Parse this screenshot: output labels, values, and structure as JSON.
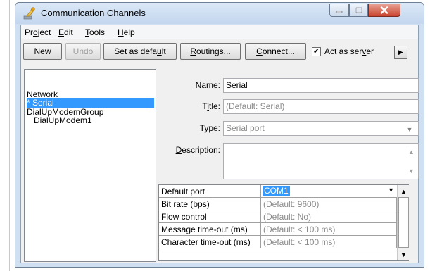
{
  "window": {
    "title": "Communication Channels",
    "icon": "app-icon",
    "controls": [
      "minimize-icon",
      "maximize-icon",
      "close-icon"
    ]
  },
  "menu": [
    {
      "pre": "Pr",
      "key": "o",
      "post": "ject"
    },
    {
      "pre": "",
      "key": "E",
      "post": "dit"
    },
    {
      "pre": "",
      "key": "T",
      "post": "ools"
    },
    {
      "pre": "",
      "key": "H",
      "post": "elp"
    }
  ],
  "toolbar": {
    "new": "New",
    "undo": "Undo",
    "set_default_pre": "Set as defa",
    "set_default_key": "u",
    "set_default_post": "lt",
    "routings_key": "R",
    "routings_post": "outings...",
    "connect_key": "C",
    "connect_post": "onnect...",
    "act_as_server_pre": "Act as ser",
    "act_as_server_key": "v",
    "act_as_server_post": "er",
    "act_as_server_checked": true
  },
  "tree": {
    "items": [
      "Network",
      "* Serial",
      "DialUpModemGroup",
      "DialUpModem1"
    ],
    "selected": "* Serial"
  },
  "form": {
    "name_label_key": "N",
    "name_label_post": "ame:",
    "name_value": "Serial",
    "title_label_pre": "T",
    "title_label_key": "i",
    "title_label_post": "tle:",
    "title_value": "(Default: Serial)",
    "type_label_pre": "T",
    "type_label_key": "y",
    "type_label_post": "pe:",
    "type_value": "Serial port",
    "description_label_key": "D",
    "description_label_post": "escription:",
    "description_value": ""
  },
  "properties": {
    "rows": [
      {
        "name": "Default port",
        "value": "COM1"
      },
      {
        "name": "Bit rate (bps)",
        "value": "(Default: 9600)"
      },
      {
        "name": "Flow control",
        "value": "(Default: No)"
      },
      {
        "name": "Message time-out (ms)",
        "value": "(Default: < 100 ms)"
      },
      {
        "name": "Character time-out (ms)",
        "value": "(Default: < 100 ms)"
      }
    ]
  },
  "colors": {
    "selection": "#3399ff",
    "window_frame": "#cfe0f3",
    "close_button": "#c9452f"
  }
}
